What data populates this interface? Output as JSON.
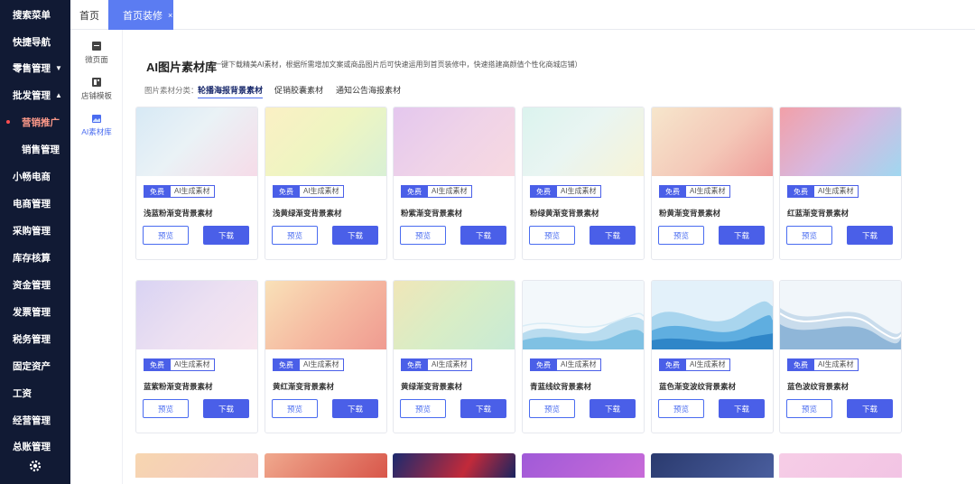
{
  "sidenav": {
    "items": [
      {
        "label": "搜索菜单"
      },
      {
        "label": "快捷导航"
      },
      {
        "label": "零售管理",
        "caret": "▼"
      },
      {
        "label": "批发管理",
        "caret": "▲"
      },
      {
        "label": "营销推广"
      },
      {
        "label": "销售管理"
      },
      {
        "label": "小畅电商"
      },
      {
        "label": "电商管理"
      },
      {
        "label": "采购管理"
      },
      {
        "label": "库存核算"
      },
      {
        "label": "资金管理"
      },
      {
        "label": "发票管理"
      },
      {
        "label": "税务管理"
      },
      {
        "label": "固定资产"
      },
      {
        "label": "工资"
      },
      {
        "label": "经营管理"
      },
      {
        "label": "总账管理"
      }
    ]
  },
  "tabs": {
    "home": "首页",
    "active": "首页装修",
    "close": "×"
  },
  "subnav": {
    "items": [
      {
        "label": "微页面",
        "icon": "page-icon"
      },
      {
        "label": "店铺模板",
        "icon": "template-icon"
      },
      {
        "label": "AI素材库",
        "icon": "image-library-icon"
      }
    ]
  },
  "main": {
    "title": "AI图片素材库",
    "description": "（一键下载精美AI素材，根据所需增加文案或商品图片后可快速运用到首页装修中，快速搭建高颜值个性化商城店铺）",
    "category_label": "图片素材分类：",
    "categories": [
      "轮播海报背景素材",
      "促销胶囊素材",
      "通知公告海报素材"
    ],
    "tag_free": "免费",
    "tag_ai": "AI生成素材",
    "btn_preview": "预览",
    "btn_download": "下载",
    "cards": [
      {
        "name": "浅蓝粉渐变背景素材"
      },
      {
        "name": "浅黄绿渐变背景素材"
      },
      {
        "name": "粉紫渐变背景素材"
      },
      {
        "name": "粉绿黄渐变背景素材"
      },
      {
        "name": "粉黄渐变背景素材"
      },
      {
        "name": "红蓝渐变背景素材"
      },
      {
        "name": "蓝紫粉渐变背景素材"
      },
      {
        "name": "黄红渐变背景素材"
      },
      {
        "name": "黄绿渐变背景素材"
      },
      {
        "name": "青蓝线纹背景素材"
      },
      {
        "name": "蓝色渐变波纹背景素材"
      },
      {
        "name": "蓝色波纹背景素材"
      }
    ]
  },
  "colors": {
    "sidebar_bg": "#111a34",
    "accent": "#4a5fe8",
    "active_tab": "#5b7cf2"
  }
}
